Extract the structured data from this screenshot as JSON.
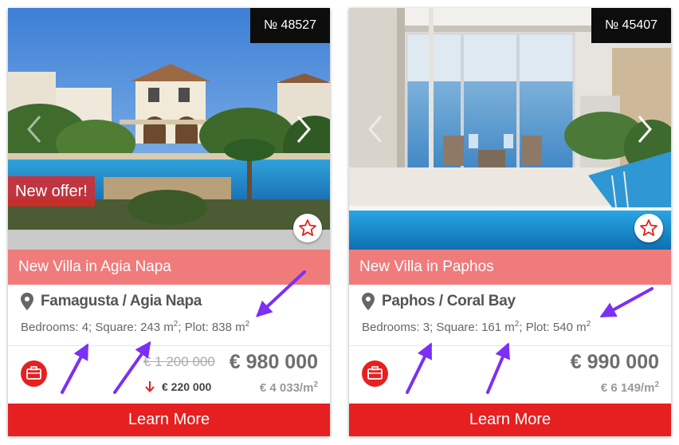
{
  "listings": [
    {
      "ref_number": "№ 48527",
      "offer_badge": "New offer!",
      "title": "New Villa in Agia Napa",
      "location": "Famagusta / Agia Napa",
      "specs": {
        "bedrooms_label": "Bedrooms: 4",
        "square_label": "Square: 243 m",
        "plot_label": "Plot: 838 m",
        "unit_sup": "2"
      },
      "old_price": "€ 1 200 000",
      "price": "€ 980 000",
      "price_drop": "€ 220 000",
      "price_per_m2": "€ 4 033/m",
      "per_m2_sup": "2",
      "cta_label": "Learn More"
    },
    {
      "ref_number": "№ 45407",
      "title": "New Villa in Paphos",
      "location": "Paphos / Coral Bay",
      "specs": {
        "bedrooms_label": "Bedrooms: 3",
        "square_label": "Square: 161 m",
        "plot_label": "Plot: 540 m",
        "unit_sup": "2"
      },
      "price": "€ 990 000",
      "price_per_m2": "€ 6 149/m",
      "per_m2_sup": "2",
      "cta_label": "Learn More"
    }
  ],
  "icons": {
    "location": "map-pin-icon",
    "favorite": "star-outline-icon",
    "commercial": "briefcase-icon",
    "price_drop": "arrow-down-icon",
    "gallery_prev": "chevron-left-icon",
    "gallery_next": "chevron-right-icon",
    "annotations": "purple-arrow-icon"
  },
  "colors": {
    "title_bar": "#f07b7b",
    "cta": "#e62020",
    "offer_badge": "#e22424",
    "ref_badge": "#0d0d0d",
    "annotation_arrows": "#7b2ff7"
  }
}
